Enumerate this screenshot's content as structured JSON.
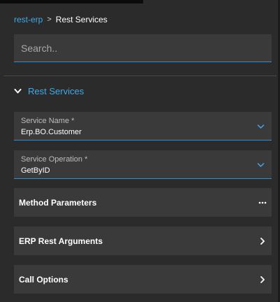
{
  "breadcrumb": {
    "root": "rest-erp",
    "separator": ">",
    "current": "Rest Services"
  },
  "search": {
    "placeholder": "Search.."
  },
  "section": {
    "title": "Rest Services",
    "icon": "chevron-down-icon"
  },
  "fields": {
    "service_name": {
      "label": "Service Name *",
      "value": "Erp.BO.Customer"
    },
    "service_operation": {
      "label": "Service Operation *",
      "value": "GetByID"
    }
  },
  "panels": {
    "method_parameters": {
      "title": "Method Parameters",
      "icon": "ellipsis-icon"
    },
    "erp_rest_arguments": {
      "title": "ERP Rest Arguments",
      "icon": "chevron-right-icon"
    },
    "call_options": {
      "title": "Call Options",
      "icon": "chevron-right-icon"
    }
  },
  "colors": {
    "accent": "#3fa9e8",
    "background": "#2b2b2b",
    "field_background": "#3a3a3a"
  }
}
